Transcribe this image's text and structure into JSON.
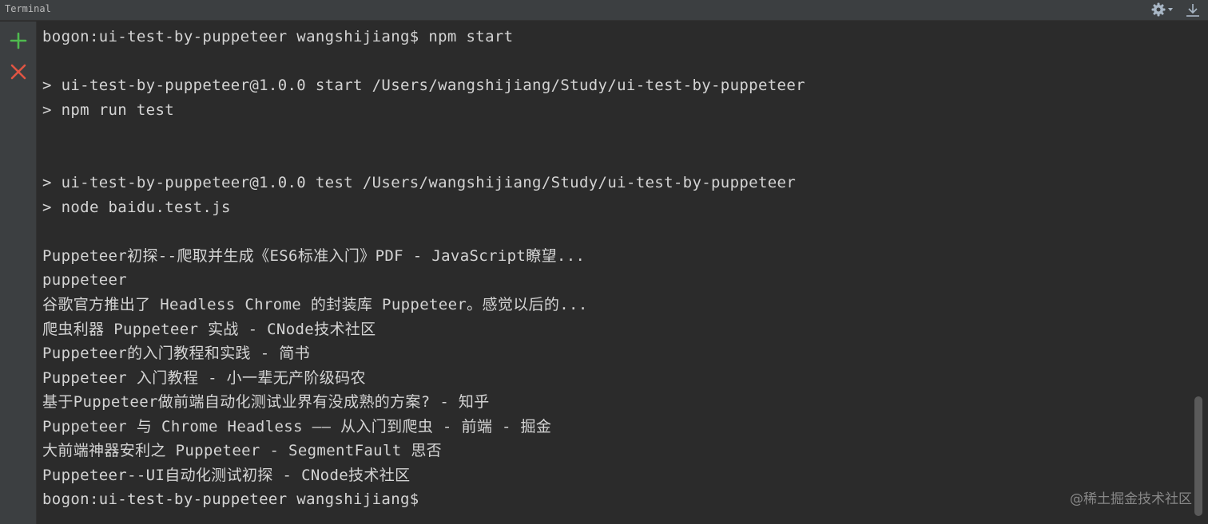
{
  "window": {
    "title": "Terminal"
  },
  "toolbar": {
    "settings_icon": "gear-icon",
    "hide_icon": "download-icon"
  },
  "toolstrip": {
    "new_session_icon": "plus-icon",
    "close_session_icon": "close-icon"
  },
  "colors": {
    "plus": "#4fbb4f",
    "close": "#e05543",
    "text": "#d4d4d4",
    "background": "#2b2b2b",
    "panel": "#3c3f41"
  },
  "terminal": {
    "lines": [
      "bogon:ui-test-by-puppeteer wangshijiang$ npm start",
      "",
      "> ui-test-by-puppeteer@1.0.0 start /Users/wangshijiang/Study/ui-test-by-puppeteer",
      "> npm run test",
      "",
      "",
      "> ui-test-by-puppeteer@1.0.0 test /Users/wangshijiang/Study/ui-test-by-puppeteer",
      "> node baidu.test.js",
      "",
      "Puppeteer初探--爬取并生成《ES6标准入门》PDF - JavaScript瞭望...",
      "puppeteer",
      "谷歌官方推出了 Headless Chrome 的封装库 Puppeteer。感觉以后的...",
      "爬虫利器 Puppeteer 实战 - CNode技术社区",
      "Puppeteer的入门教程和实践 - 简书",
      "Puppeteer 入门教程 - 小一辈无产阶级码农",
      "基于Puppeteer做前端自动化测试业界有没成熟的方案? - 知乎",
      "Puppeteer 与 Chrome Headless —— 从入门到爬虫 - 前端 - 掘金",
      "大前端神器安利之 Puppeteer - SegmentFault 思否",
      "Puppeteer--UI自动化测试初探 - CNode技术社区",
      "bogon:ui-test-by-puppeteer wangshijiang$"
    ]
  },
  "watermark": "@稀土掘金技术社区"
}
